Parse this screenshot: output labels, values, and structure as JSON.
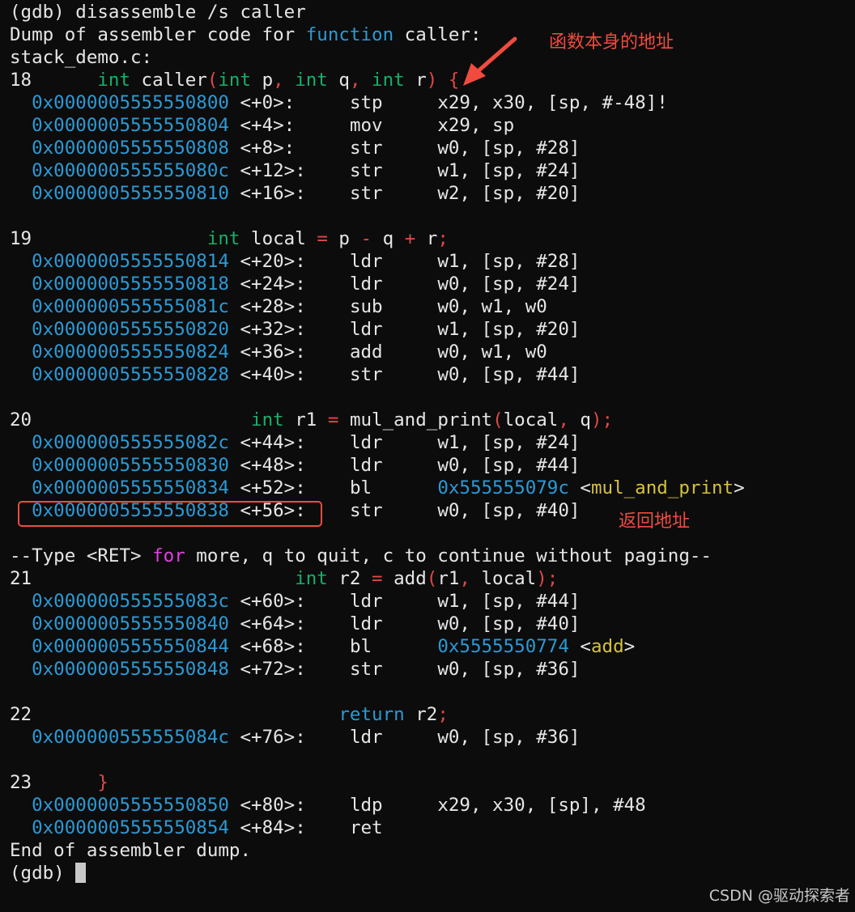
{
  "terminal": {
    "prompt": "(gdb)",
    "command": " disassemble /s caller",
    "header": {
      "dump_prefix": "Dump of assembler code for ",
      "function_keyword": "function",
      "dump_suffix": " caller:",
      "source_file": "stack_demo.c:"
    },
    "src18": {
      "lineno": "18",
      "indent": "      ",
      "kw": "int",
      "pre": " caller",
      "paren_open": "(",
      "kw2": "int",
      "p": " p",
      "comma1": ",",
      "sp1": " ",
      "kw3": "int",
      "q": " q",
      "comma2": ",",
      "sp2": " ",
      "kw4": "int",
      "r": " r",
      "paren_close": ")",
      "sp3": " ",
      "brace": "{"
    },
    "src19": {
      "lineno": "19",
      "indent": "                ",
      "kw": "int",
      "pre": " local ",
      "eq": "=",
      "p": " p ",
      "minus": "-",
      "q": " q ",
      "plus": "+",
      "r": " r",
      "semi": ";"
    },
    "src20": {
      "lineno": "20",
      "indent": "                    ",
      "kw": "int",
      "pre": " r1 ",
      "eq": "=",
      "call": " mul_and_print",
      "paren_open": "(",
      "a1": "local",
      "comma": ",",
      "a2": " q",
      "paren_close": ")",
      "semi": ";"
    },
    "src21": {
      "lineno": "21",
      "indent": "                        ",
      "kw": "int",
      "pre": " r2 ",
      "eq": "=",
      "call": " add",
      "paren_open": "(",
      "a1": "r1",
      "comma": ",",
      "a2": " local",
      "paren_close": ")",
      "semi": ";"
    },
    "src22": {
      "lineno": "22",
      "indent": "                            ",
      "kw": "return",
      "val": " r2",
      "semi": ";"
    },
    "src23": {
      "lineno": "23",
      "indent": "      ",
      "brace": "}"
    },
    "instructions": [
      {
        "addr": "0x0000005555550800",
        "off": " <+0>:     ",
        "mnem": "stp     ",
        "ops": "x29, x30, [sp, #-48]!"
      },
      {
        "addr": "0x0000005555550804",
        "off": " <+4>:     ",
        "mnem": "mov     ",
        "ops": "x29, sp"
      },
      {
        "addr": "0x0000005555550808",
        "off": " <+8>:     ",
        "mnem": "str     ",
        "ops": "w0, [sp, #28]"
      },
      {
        "addr": "0x000000555555080c",
        "off": " <+12>:    ",
        "mnem": "str     ",
        "ops": "w1, [sp, #24]"
      },
      {
        "addr": "0x0000005555550810",
        "off": " <+16>:    ",
        "mnem": "str     ",
        "ops": "w2, [sp, #20]"
      },
      {
        "addr": "0x0000005555550814",
        "off": " <+20>:    ",
        "mnem": "ldr     ",
        "ops": "w1, [sp, #28]"
      },
      {
        "addr": "0x0000005555550818",
        "off": " <+24>:    ",
        "mnem": "ldr     ",
        "ops": "w0, [sp, #24]"
      },
      {
        "addr": "0x000000555555081c",
        "off": " <+28>:    ",
        "mnem": "sub     ",
        "ops": "w0, w1, w0"
      },
      {
        "addr": "0x0000005555550820",
        "off": " <+32>:    ",
        "mnem": "ldr     ",
        "ops": "w1, [sp, #20]"
      },
      {
        "addr": "0x0000005555550824",
        "off": " <+36>:    ",
        "mnem": "add     ",
        "ops": "w0, w1, w0"
      },
      {
        "addr": "0x0000005555550828",
        "off": " <+40>:    ",
        "mnem": "str     ",
        "ops": "w0, [sp, #44]"
      },
      {
        "addr": "0x000000555555082c",
        "off": " <+44>:    ",
        "mnem": "ldr     ",
        "ops": "w1, [sp, #24]"
      },
      {
        "addr": "0x0000005555550830",
        "off": " <+48>:    ",
        "mnem": "ldr     ",
        "ops": "w0, [sp, #44]"
      },
      {
        "addr": "0x0000005555550834",
        "off": " <+52>:    ",
        "mnem": "bl      ",
        "target": "0x555555079c",
        "sym_open": " <",
        "sym": "mul_and_print",
        "sym_close": ">"
      },
      {
        "addr": "0x0000005555550838",
        "off": " <+56>:    ",
        "mnem": "str     ",
        "ops": "w0, [sp, #40]"
      },
      {
        "addr": "0x000000555555083c",
        "off": " <+60>:    ",
        "mnem": "ldr     ",
        "ops": "w1, [sp, #44]"
      },
      {
        "addr": "0x0000005555550840",
        "off": " <+64>:    ",
        "mnem": "ldr     ",
        "ops": "w0, [sp, #40]"
      },
      {
        "addr": "0x0000005555550844",
        "off": " <+68>:    ",
        "mnem": "bl      ",
        "target": "0x5555550774",
        "sym_open": " <",
        "sym": "add",
        "sym_close": ">"
      },
      {
        "addr": "0x0000005555550848",
        "off": " <+72>:    ",
        "mnem": "str     ",
        "ops": "w0, [sp, #36]"
      },
      {
        "addr": "0x000000555555084c",
        "off": " <+76>:    ",
        "mnem": "ldr     ",
        "ops": "w0, [sp, #36]"
      },
      {
        "addr": "0x0000005555550850",
        "off": " <+80>:    ",
        "mnem": "ldp     ",
        "ops": "x29, x30, [sp], #48"
      },
      {
        "addr": "0x0000005555550854",
        "off": " <+84>:    ",
        "mnem": "ret",
        "ops": ""
      }
    ],
    "pager": {
      "pre": "--Type <RET> ",
      "kw": "for",
      "post": " more, q to quit, c to continue without paging--"
    },
    "footer": "End of assembler dump.",
    "final_prompt": "(gdb) "
  },
  "annotations": {
    "function_address": "函数本身的地址",
    "return_address": "返回地址"
  },
  "watermark": "CSDN @驱动探索者",
  "colors": {
    "background": "#0c0c0c",
    "address": "#2b9ad6",
    "keyword": "#16b06a",
    "annotation": "#f04b3e"
  },
  "icons": [
    "annotation-arrow-icon",
    "cursor-block-icon"
  ]
}
